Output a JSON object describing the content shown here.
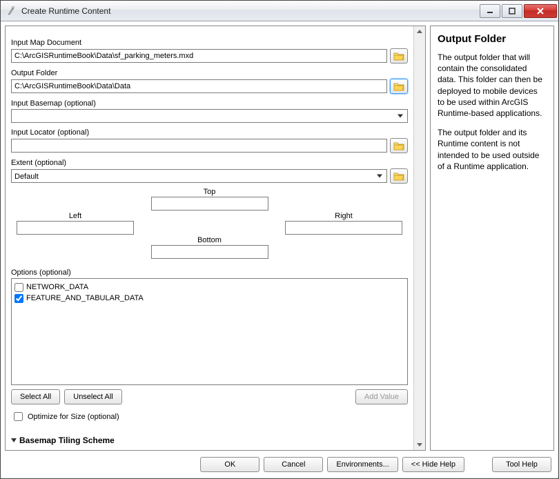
{
  "window": {
    "title": "Create Runtime Content"
  },
  "form": {
    "inputMap": {
      "label": "Input Map Document",
      "value": "C:\\ArcGISRuntimeBook\\Data\\sf_parking_meters.mxd"
    },
    "outputFolder": {
      "label": "Output Folder",
      "value": "C:\\ArcGISRuntimeBook\\Data\\Data"
    },
    "inputBasemap": {
      "label": "Input Basemap (optional)",
      "value": ""
    },
    "inputLocator": {
      "label": "Input Locator (optional)",
      "value": ""
    },
    "extent": {
      "label": "Extent (optional)",
      "value": "Default",
      "top": {
        "label": "Top",
        "value": ""
      },
      "left": {
        "label": "Left",
        "value": ""
      },
      "right": {
        "label": "Right",
        "value": ""
      },
      "bottom": {
        "label": "Bottom",
        "value": ""
      }
    },
    "options": {
      "label": "Options (optional)",
      "items": [
        {
          "label": "NETWORK_DATA",
          "checked": false
        },
        {
          "label": "FEATURE_AND_TABULAR_DATA",
          "checked": true
        }
      ],
      "selectAll": "Select All",
      "unselectAll": "Unselect All",
      "addValue": "Add Value"
    },
    "optimize": {
      "label": "Optimize for Size (optional)",
      "checked": false
    },
    "basemapScheme": {
      "label": "Basemap Tiling Scheme"
    }
  },
  "help": {
    "title": "Output Folder",
    "p1": "The output folder that will contain the consolidated data. This folder can then be deployed to mobile devices to be used within ArcGIS Runtime-based applications.",
    "p2": "The output folder and its Runtime content is not intended to be used outside of a Runtime application."
  },
  "buttons": {
    "ok": "OK",
    "cancel": "Cancel",
    "env": "Environments...",
    "hideHelp": "<< Hide Help",
    "toolHelp": "Tool Help"
  }
}
